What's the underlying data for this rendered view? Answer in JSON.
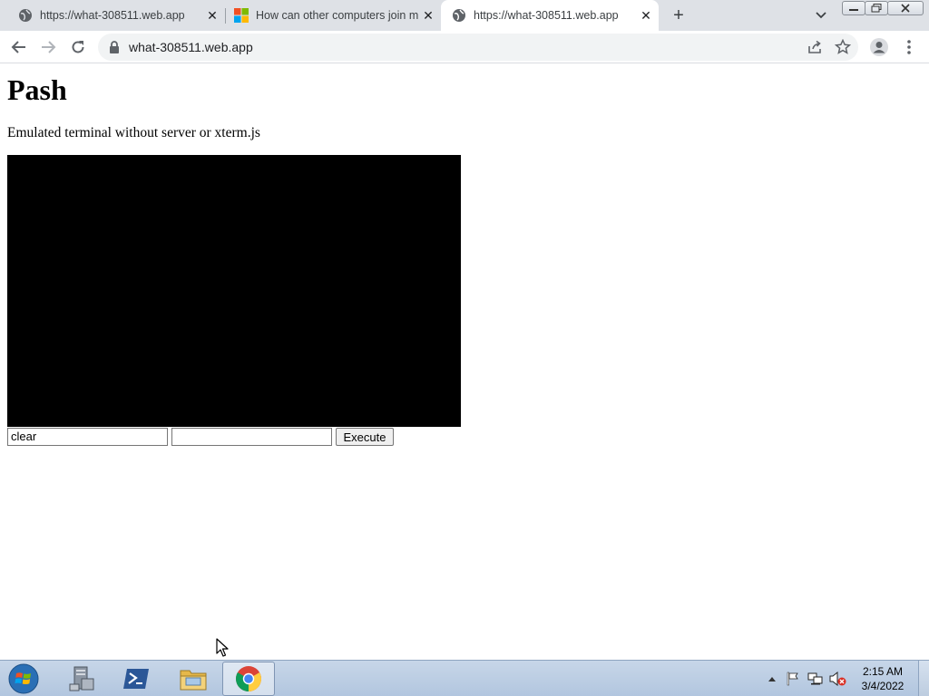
{
  "browser": {
    "tabs": [
      {
        "title": "https://what-308511.web.app",
        "favicon": "globe-icon",
        "active": false
      },
      {
        "title": "How can other computers join m",
        "favicon": "microsoft-logo-icon",
        "active": false
      },
      {
        "title": "https://what-308511.web.app",
        "favicon": "globe-icon",
        "active": true
      }
    ],
    "new_tab_glyph": "+",
    "close_glyph": "✕",
    "address_bar": {
      "url": "what-308511.web.app"
    }
  },
  "page": {
    "heading": "Pash",
    "subtitle": "Emulated terminal without server or xterm.js",
    "terminal_background": "#000000",
    "command_input": {
      "value": "clear"
    },
    "args_input": {
      "value": ""
    },
    "execute_label": "Execute"
  },
  "taskbar": {
    "apps": [
      "server-manager-icon",
      "powershell-icon",
      "file-explorer-icon",
      "chrome-icon"
    ],
    "active_app": "chrome-icon",
    "tray_icons": [
      "show-hidden-icons-arrow",
      "action-center-flag-icon",
      "network-icon",
      "volume-muted-icon"
    ],
    "clock": {
      "time": "2:15 AM",
      "date": "3/4/2022"
    }
  }
}
